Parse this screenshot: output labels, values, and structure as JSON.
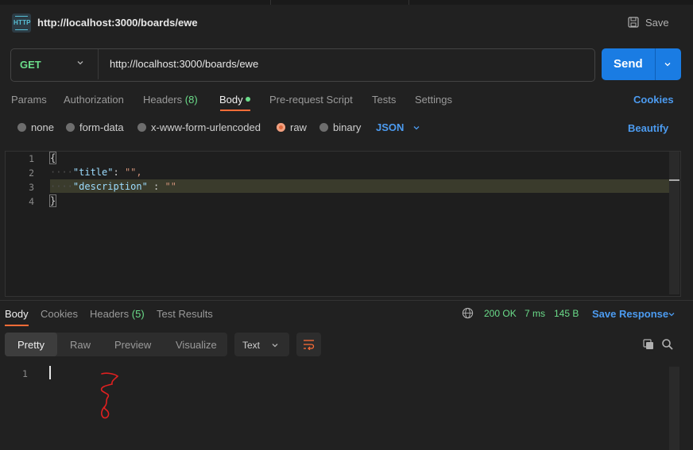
{
  "request": {
    "title": "http://localhost:3000/boards/ewe",
    "save_label": "Save",
    "method": "GET",
    "url": "http://localhost:3000/boards/ewe",
    "send_label": "Send"
  },
  "request_tabs": {
    "params": "Params",
    "authorization": "Authorization",
    "headers": "Headers",
    "headers_count": "(8)",
    "body": "Body",
    "pre_request": "Pre-request Script",
    "tests": "Tests",
    "settings": "Settings",
    "cookies": "Cookies"
  },
  "body_types": {
    "none": "none",
    "form_data": "form-data",
    "urlencoded": "x-www-form-urlencoded",
    "raw": "raw",
    "binary": "binary",
    "selected": "raw",
    "format": "JSON",
    "beautify": "Beautify"
  },
  "editor": {
    "line_numbers": [
      "1",
      "2",
      "3",
      "4"
    ],
    "open_brace": "{",
    "close_brace": "}",
    "indent": "····",
    "line2_key": "\"title\"",
    "line2_sep": ": ",
    "line2_val": "\"\",",
    "line3_key": "\"description\"",
    "line3_sep": " : ",
    "line3_val": "\"\""
  },
  "response_tabs": {
    "body": "Body",
    "cookies": "Cookies",
    "headers": "Headers",
    "headers_count": "(5)",
    "test_results": "Test Results"
  },
  "response_status": {
    "status": "200 OK",
    "time": "7 ms",
    "size": "145 B",
    "save_response": "Save Response"
  },
  "response_view": {
    "pretty": "Pretty",
    "raw": "Raw",
    "preview": "Preview",
    "visualize": "Visualize",
    "format": "Text",
    "line_numbers": [
      "1"
    ]
  },
  "colors": {
    "accent": "#ff6c37",
    "send": "#1a7ce3",
    "method_get": "#6bdd8a",
    "link": "#4c9bf0"
  }
}
